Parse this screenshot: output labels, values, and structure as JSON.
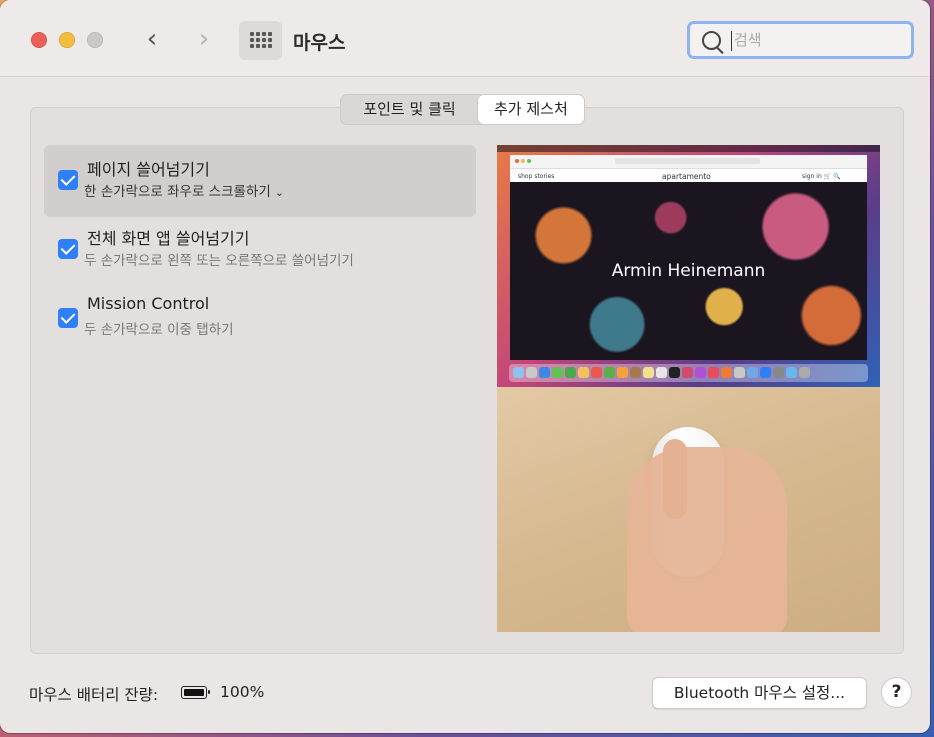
{
  "window": {
    "title": "마우스",
    "back_glyph": "‹",
    "forward_glyph": "›"
  },
  "search": {
    "placeholder": "검색",
    "value": ""
  },
  "tabs": [
    {
      "label": "포인트 및 클릭",
      "active": false
    },
    {
      "label": "추가 제스처",
      "active": true
    }
  ],
  "options": [
    {
      "title": "페이지 쓸어넘기기",
      "subtitle": "한 손가락으로 좌우로 스크롤하기",
      "has_dropdown": true,
      "checked": true,
      "selected": true
    },
    {
      "title": "전체 화면 앱 쓸어넘기기",
      "subtitle": "두 손가락으로 왼쪽 또는 오른쪽으로 쓸어넘기기",
      "checked": true,
      "selected": false
    },
    {
      "title": "Mission Control",
      "subtitle": "두 손가락으로 이중 탭하기",
      "checked": true,
      "selected": false
    }
  ],
  "dropdown_glyph": "⌄",
  "preview": {
    "site_nav_left": "shop   stories",
    "site_name": "apartamento",
    "site_nav_right": "sign in   🛒   🔍",
    "hero_text": "Armin Heinemann"
  },
  "footer": {
    "battery_label": "마우스 배터리 잔량:",
    "battery_percent": "100%",
    "bluetooth_button": "Bluetooth 마우스 설정...",
    "help_label": "?"
  },
  "colors": {
    "accent": "#2f7ff6",
    "close": "#ec5f57",
    "minimize": "#f2bd3b",
    "focus_ring": "#8fb2f5"
  }
}
